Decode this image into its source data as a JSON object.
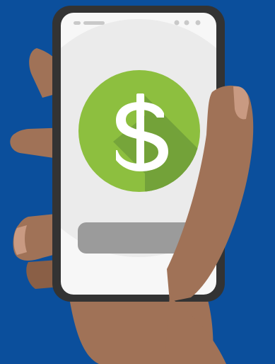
{
  "scene": {
    "icon": "dollar-sign-icon",
    "colors": {
      "background": "#0b4f9c",
      "skin": "#a07257",
      "skin_shadow": "#8a5f46",
      "fingernail": "#c99a82",
      "phone_frame": "#333333",
      "screen": "#f7f7f7",
      "screen_circle": "#ebebeb",
      "coin_green": "#8dbf3f",
      "coin_shadow": "#73a23a",
      "dollar_sign": "#ffffff",
      "button_gray": "#9b9b9b",
      "status_indicator": "#c9c9c9"
    }
  }
}
